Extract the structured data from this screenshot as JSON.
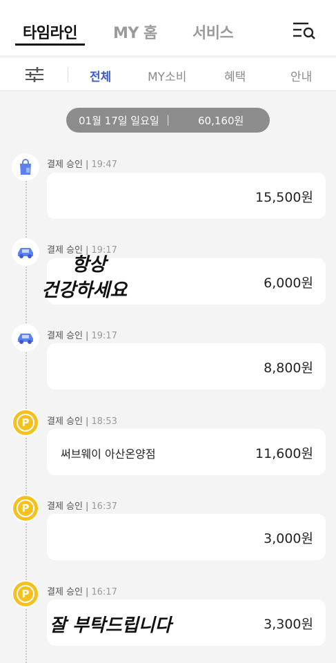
{
  "top_tabs": [
    {
      "label": "타임라인",
      "active": true
    },
    {
      "label": "MY 홈",
      "active": false
    },
    {
      "label": "서비스",
      "active": false
    }
  ],
  "top_icons": {
    "menu_search": "menu-search-icon"
  },
  "filter_tabs": [
    {
      "label": "전체",
      "active": true
    },
    {
      "label": "MY소비",
      "active": false
    },
    {
      "label": "혜택",
      "active": false
    },
    {
      "label": "안내",
      "active": false
    }
  ],
  "filter_icon": "sliders-icon",
  "date_summary": {
    "date": "01월 17일 일요일",
    "separator": "|",
    "total": "60,160원"
  },
  "entries": [
    {
      "icon": "shopping-bag-icon",
      "status": "결제 승인",
      "time": "19:47",
      "merchant": "",
      "amount": "15,500원"
    },
    {
      "icon": "car-icon",
      "status": "결제 승인",
      "time": "19:17",
      "merchant": "",
      "amount": "6,000원"
    },
    {
      "icon": "car-icon",
      "status": "결제 승인",
      "time": "19:17",
      "merchant": "",
      "amount": "8,800원"
    },
    {
      "icon": "point-coin-icon",
      "status": "결제 승인",
      "time": "18:53",
      "merchant": "써브웨이 아산온양점",
      "amount": "11,600원"
    },
    {
      "icon": "point-coin-icon",
      "status": "결제 승인",
      "time": "16:37",
      "merchant": "",
      "amount": "3,000원"
    },
    {
      "icon": "point-coin-icon",
      "status": "결제 승인",
      "time": "16:17",
      "merchant": "",
      "amount": "3,300원"
    }
  ],
  "coin_letter": "P",
  "handwritten_notes": [
    "항상",
    "건강하세요",
    "잘 부탁드립니다"
  ],
  "colors": {
    "accent_blue": "#3b5bc9",
    "coin_yellow": "#f6c11f",
    "icon_blue": "#5b83f0",
    "pill_gray": "#8c8c8c"
  }
}
